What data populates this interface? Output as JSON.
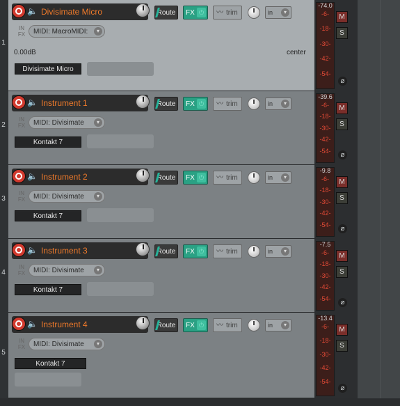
{
  "tracks": [
    {
      "index": "1",
      "name": "Divisimate Micro",
      "midi": "MIDI: MacroMIDI:",
      "volume": "0.00dB",
      "pan": "center",
      "plugin": "Divisimate Micro",
      "peak": "-74.0",
      "selected": true
    },
    {
      "index": "2",
      "name": "Instrument 1",
      "midi": "MIDI: Divisimate",
      "plugin": "Kontakt 7",
      "peak": "-39.6",
      "selected": false
    },
    {
      "index": "3",
      "name": "Instrument 2",
      "midi": "MIDI: Divisimate",
      "plugin": "Kontakt 7",
      "peak": "-9.8",
      "selected": false
    },
    {
      "index": "4",
      "name": "Instrument 3",
      "midi": "MIDI: Divisimate",
      "plugin": "Kontakt 7",
      "peak": "-7.5",
      "selected": false
    },
    {
      "index": "5",
      "name": "Instrument 4",
      "midi": "MIDI: Divisimate",
      "plugin": "Kontakt 7",
      "peak": "-13.4",
      "selected": false
    }
  ],
  "labels": {
    "route": "Route",
    "fx": "FX",
    "trim": "trim",
    "input": "in",
    "in_fx_top": "IN",
    "in_fx_bottom": "FX",
    "mute": "M",
    "solo": "S",
    "phase": "⌀"
  },
  "meter_scale": [
    "-6-",
    "-18-",
    "-30-",
    "-42-",
    "-54-"
  ],
  "colors": {
    "track_name": "#f07a2a",
    "meter_label": "#e14a36",
    "fx_active": "#2aa184"
  }
}
